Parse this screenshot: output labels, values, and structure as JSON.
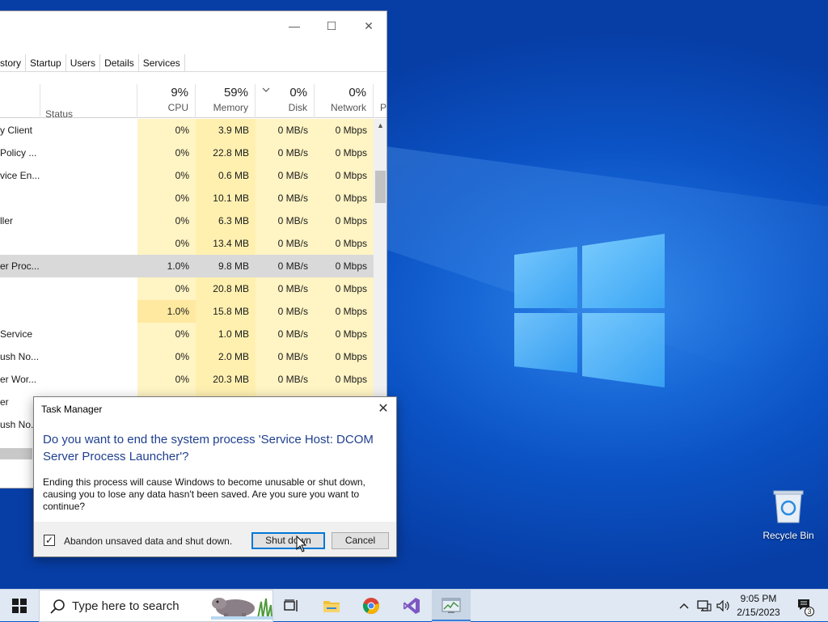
{
  "task_manager": {
    "window_controls": {
      "minimize": "—",
      "maximize": "☐",
      "close": "✕"
    },
    "tabs": [
      "story",
      "Startup",
      "Users",
      "Details",
      "Services"
    ],
    "columns": {
      "status": "Status",
      "cpu": {
        "percent": "9%",
        "label": "CPU"
      },
      "memory": {
        "percent": "59%",
        "label": "Memory"
      },
      "disk": {
        "percent": "0%",
        "label": "Disk"
      },
      "network": {
        "percent": "0%",
        "label": "Network"
      },
      "power": "P"
    },
    "rows": [
      {
        "name": "y Client",
        "cpu": "0%",
        "memory": "3.9 MB",
        "disk": "0 MB/s",
        "network": "0 Mbps"
      },
      {
        "name": "Policy ...",
        "cpu": "0%",
        "memory": "22.8 MB",
        "disk": "0 MB/s",
        "network": "0 Mbps"
      },
      {
        "name": "vice En...",
        "cpu": "0%",
        "memory": "0.6 MB",
        "disk": "0 MB/s",
        "network": "0 Mbps"
      },
      {
        "name": "",
        "cpu": "0%",
        "memory": "10.1 MB",
        "disk": "0 MB/s",
        "network": "0 Mbps"
      },
      {
        "name": "ller",
        "cpu": "0%",
        "memory": "6.3 MB",
        "disk": "0 MB/s",
        "network": "0 Mbps"
      },
      {
        "name": "",
        "cpu": "0%",
        "memory": "13.4 MB",
        "disk": "0 MB/s",
        "network": "0 Mbps"
      },
      {
        "name": "er Proc...",
        "cpu": "1.0%",
        "memory": "9.8 MB",
        "disk": "0 MB/s",
        "network": "0 Mbps",
        "selected": true
      },
      {
        "name": "",
        "cpu": "0%",
        "memory": "20.8 MB",
        "disk": "0 MB/s",
        "network": "0 Mbps"
      },
      {
        "name": "",
        "cpu": "1.0%",
        "memory": "15.8 MB",
        "disk": "0 MB/s",
        "network": "0 Mbps"
      },
      {
        "name": " Service",
        "cpu": "0%",
        "memory": "1.0 MB",
        "disk": "0 MB/s",
        "network": "0 Mbps"
      },
      {
        "name": "ush No...",
        "cpu": "0%",
        "memory": "2.0 MB",
        "disk": "0 MB/s",
        "network": "0 Mbps"
      },
      {
        "name": "er Wor...",
        "cpu": "0%",
        "memory": "20.3 MB",
        "disk": "0 MB/s",
        "network": "0 Mbps"
      },
      {
        "name": "er",
        "cpu": "",
        "memory": "",
        "disk": "",
        "network": ""
      },
      {
        "name": "ush No...",
        "cpu": "",
        "memory": "",
        "disk": "",
        "network": ""
      }
    ]
  },
  "dialog": {
    "title": "Task Manager",
    "close": "✕",
    "main_instruction": "Do you want to end the system process 'Service Host: DCOM Server Process Launcher'?",
    "content": "Ending this process will cause Windows to become unusable or shut down, causing you to lose any data hasn't been saved. Are you sure you want to continue?",
    "checkbox_label": "Abandon unsaved data and shut down.",
    "checkbox_checked": true,
    "checkbox_mark": "✓",
    "primary_button": "Shut down",
    "cancel_button": "Cancel"
  },
  "desktop": {
    "recycle_bin_label": "Recycle Bin"
  },
  "taskbar": {
    "search_placeholder": "Type here to search",
    "pinned_apps": [
      "task-view",
      "file-explorer",
      "chrome",
      "visual-studio",
      "task-manager"
    ],
    "clock_time": "9:05 PM",
    "clock_date": "2/15/2023",
    "notification_count": "3"
  },
  "colors": {
    "desktop_blue": "#0b52c4",
    "dialog_heading": "#1f3f8f",
    "heat_light": "#fff4c4",
    "heat_medium": "#fff0b0",
    "focus_blue": "#0078d7"
  }
}
